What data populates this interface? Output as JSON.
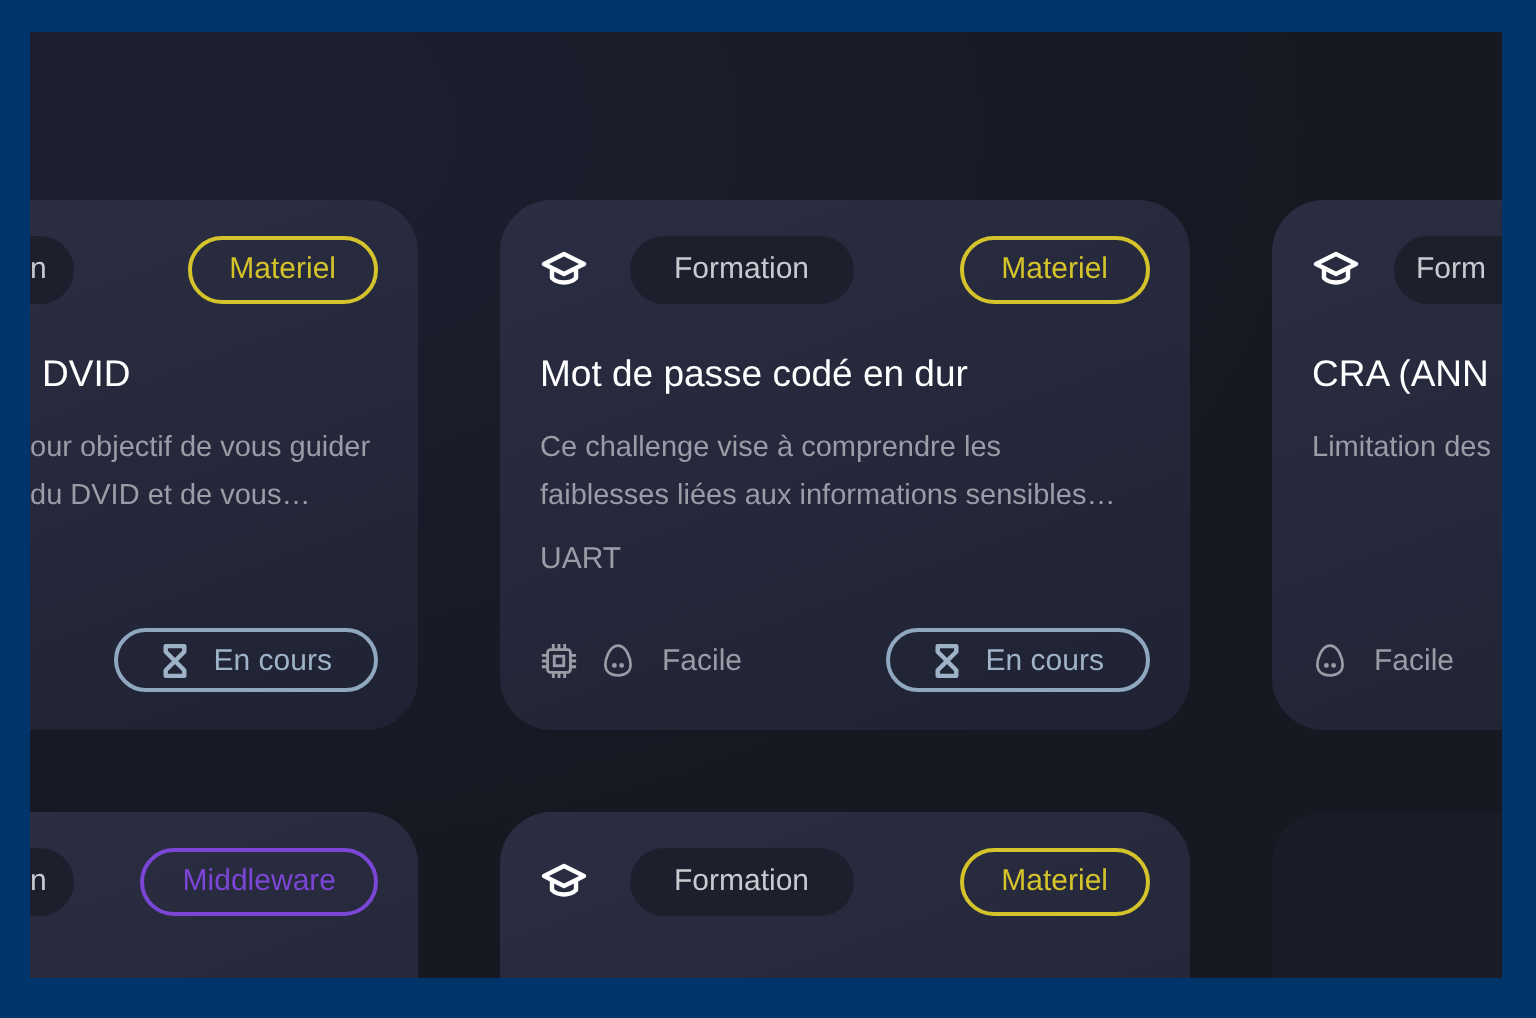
{
  "rows": [
    {
      "cards": [
        {
          "kind": "card",
          "category": "n",
          "tag": {
            "label": "Materiel",
            "color": "#d4c32a"
          },
          "title": "DVID",
          "description": [
            "our objectif de vous guider",
            "du DVID et de vous…"
          ],
          "status": "En cours"
        },
        {
          "kind": "card",
          "category": "Formation",
          "tag": {
            "label": "Materiel",
            "color": "#d4c32a"
          },
          "title": "Mot de passe codé en dur",
          "description": [
            "Ce challenge vise à comprendre les",
            "faiblesses liées aux informations sensibles…"
          ],
          "protocol": "UART",
          "difficulty": "Facile",
          "status": "En cours"
        },
        {
          "kind": "card",
          "category": "Form",
          "title": "CRA (ANN",
          "description": [
            "Limitation des"
          ],
          "difficulty": "Facile"
        }
      ]
    },
    {
      "cards": [
        {
          "kind": "card",
          "category": "n",
          "tag": {
            "label": "Middleware",
            "color": "#7b46d6"
          }
        },
        {
          "kind": "card",
          "category": "Formation",
          "tag": {
            "label": "Materiel",
            "color": "#d4c32a"
          }
        },
        {
          "kind": "blurred"
        }
      ]
    }
  ]
}
